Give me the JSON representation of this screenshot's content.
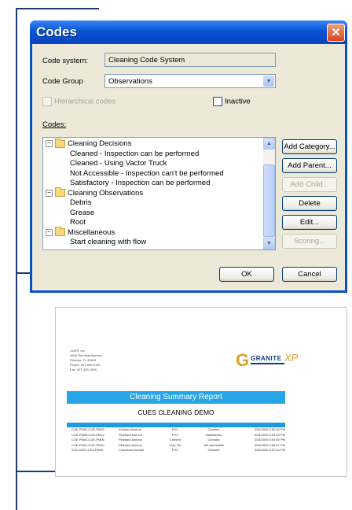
{
  "dialog": {
    "title": "Codes",
    "code_system_label": "Code system:",
    "code_system_value": "Cleaning Code System",
    "code_group_label": "Code Group",
    "code_group_value": "Observations",
    "hierarchical_label": "Hierarchical codes",
    "inactive_label": "Inactive",
    "codes_label": "Codes:",
    "tree": [
      {
        "label": "Cleaning Decisions",
        "type": "category"
      },
      {
        "label": "Cleaned - Inspection can be performed",
        "type": "code"
      },
      {
        "label": "Cleaned - Using Vactor Truck",
        "type": "code"
      },
      {
        "label": "Not Accessible - Inspection can't be performed",
        "type": "code"
      },
      {
        "label": "Satisfactory - Inspection can be performed",
        "type": "code"
      },
      {
        "label": "Cleaning Observations",
        "type": "category"
      },
      {
        "label": "Debris",
        "type": "code"
      },
      {
        "label": "Grease",
        "type": "code"
      },
      {
        "label": "Root",
        "type": "code"
      },
      {
        "label": "Miscellaneous",
        "type": "category"
      },
      {
        "label": "Start cleaning with flow",
        "type": "code"
      }
    ],
    "buttons": {
      "add_category": "Add Category...",
      "add_parent": "Add Parent...",
      "add_child": "Add Child...",
      "delete": "Delete",
      "edit": "Edit...",
      "scoring": "Scoring...",
      "ok": "OK",
      "cancel": "Cancel"
    },
    "close_glyph": "✕"
  },
  "report": {
    "address": [
      "CUES, Inc.",
      "3600 Rio Vista Avenue",
      "Orlando, FL 32805",
      "Phone: 407-849-0190",
      "Fax: 407-425-1569"
    ],
    "logo_text": "GRANITE",
    "logo_suffix": "XP",
    "banner": "Cleaning Summary Report",
    "subtitle": "CUES CLEANING DEMO",
    "rows": [
      [
        "CUE-PM02-CUE-PM03",
        "Kirkland Avenue",
        "PVC",
        "Cleaned",
        "3/24/2009 3:52:30 PM"
      ],
      [
        "CUE-PM03-CUE-PM12",
        "Pineland Avenue",
        "PVC",
        "Satisfactory",
        "3/24/2009 3:53:43 PM"
      ],
      [
        "CUE-PM03-CUE-PM06",
        "Pineland Avenue",
        "Cement",
        "Cleaned",
        "3/24/2009 3:54:50 PM"
      ],
      [
        "CUE-PM11-CUE-PM10",
        "Pineland Avenue",
        "Clay Tile",
        "Not accessible",
        "3/24/2009 3:56:57 PM"
      ],
      [
        "SCE-M302-CE1-PM30",
        "Columbus Avenue",
        "PVC",
        "Cleaned",
        "3/24/2009 3:57:44 PM"
      ]
    ]
  },
  "colors": {
    "title_bar": "#0a52d6",
    "dialog_face": "#ece9d8",
    "report_banner": "#27a5e6",
    "bracket": "#1f3b73"
  }
}
